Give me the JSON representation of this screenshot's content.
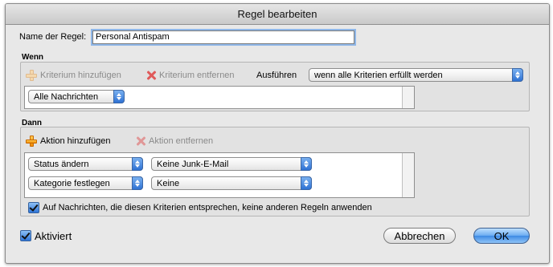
{
  "window": {
    "title": "Regel bearbeiten"
  },
  "rule_name": {
    "label": "Name der Regel:",
    "value": "Personal Antispam"
  },
  "wenn": {
    "heading": "Wenn",
    "add_criterion": "Kriterium hinzufügen",
    "remove_criterion": "Kriterium entfernen",
    "execute_label": "Ausführen",
    "execute_select": "wenn alle Kriterien erfüllt werden",
    "criteria": [
      {
        "select": "Alle Nachrichten"
      }
    ]
  },
  "dann": {
    "heading": "Dann",
    "add_action": "Aktion hinzufügen",
    "remove_action": "Aktion entfernen",
    "actions": [
      {
        "action": "Status ändern",
        "value": "Keine Junk-E-Mail"
      },
      {
        "action": "Kategorie festlegen",
        "value": "Keine"
      }
    ],
    "stop_rules_checkbox": "Auf Nachrichten, die diesen Kriterien entsprechen, keine anderen Regeln anwenden"
  },
  "activated_checkbox": "Aktiviert",
  "buttons": {
    "cancel": "Abbrechen",
    "ok": "OK"
  },
  "colors": {
    "accent": "#3d8ae4",
    "focus_ring": "#8fb7e8",
    "add_icon": "#f08a00",
    "remove_icon": "#e05a5a"
  }
}
